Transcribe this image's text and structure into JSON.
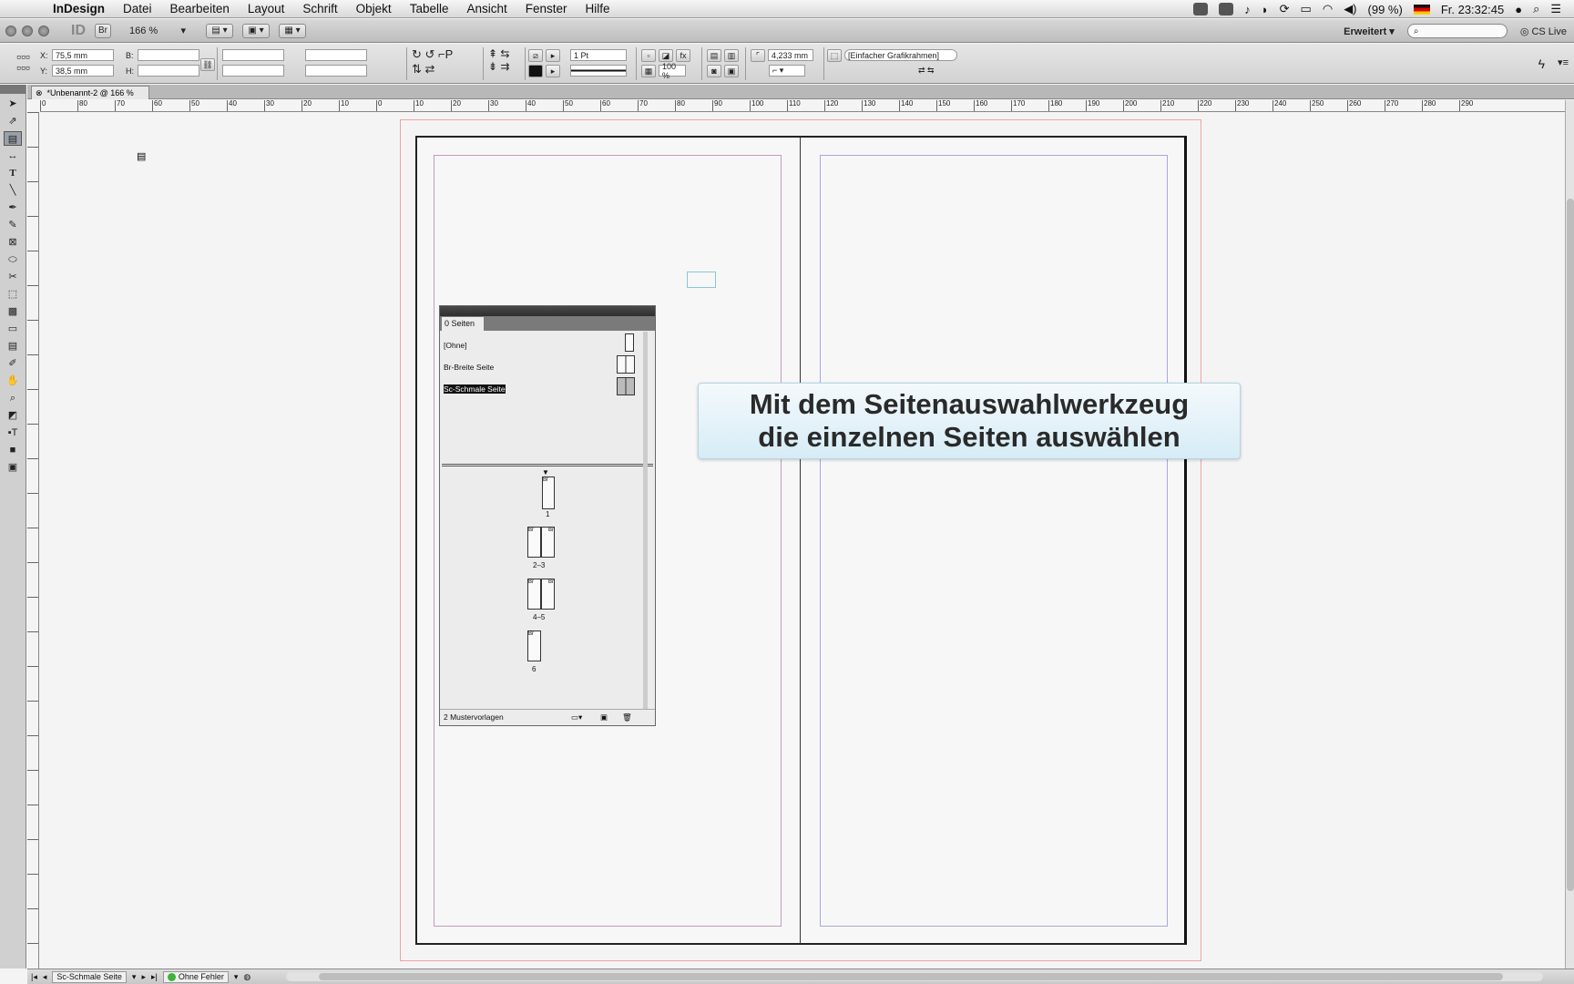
{
  "menubar": {
    "app_name": "InDesign",
    "items": [
      "Datei",
      "Bearbeiten",
      "Layout",
      "Schrift",
      "Objekt",
      "Tabelle",
      "Ansicht",
      "Fenster",
      "Hilfe"
    ],
    "battery": "(99 %)",
    "clock": "Fr. 23:32:45"
  },
  "appbar": {
    "logo": "ID",
    "bridge": "Br",
    "zoom": "166 %",
    "workspace": "Erweitert ▾",
    "cs_live": "CS Live"
  },
  "control": {
    "x_label": "X:",
    "x_value": "75,5 mm",
    "y_label": "Y:",
    "y_value": "38,5 mm",
    "w_label": "B:",
    "h_label": "H:",
    "stroke_weight": "1 Pt",
    "opacity": "100 %",
    "offset": "4,233 mm",
    "object_style": "[Einfacher Grafikrahmen]"
  },
  "document": {
    "tab_title": "*Unbenannt-2 @ 166 %"
  },
  "hruler_labels": [
    "0",
    "80",
    "70",
    "60",
    "50",
    "40",
    "30",
    "20",
    "10",
    "0",
    "10",
    "20",
    "30",
    "40",
    "50",
    "60",
    "70",
    "80",
    "90",
    "100",
    "110",
    "120",
    "130",
    "140",
    "150",
    "160",
    "170",
    "180",
    "190",
    "200",
    "210",
    "220",
    "230",
    "240",
    "250",
    "260",
    "270",
    "280",
    "290"
  ],
  "pages_panel": {
    "tab_label": "0 Seiten",
    "masters": [
      {
        "label": "[Ohne]"
      },
      {
        "label": "Br-Breite Seite"
      },
      {
        "label": "Sc-Schmale Seite",
        "selected": true
      }
    ],
    "pages": [
      {
        "label": "1",
        "prefix": "Br"
      },
      {
        "label": "2–3",
        "prefix_l": "Br",
        "prefix_r": "Br"
      },
      {
        "label": "4–5",
        "prefix_l": "Br",
        "prefix_r": "Br"
      },
      {
        "label": "6",
        "prefix": "Br"
      }
    ],
    "footer": "2 Mustervorlagen"
  },
  "caption": {
    "line1": "Mit dem Seitenauswahlwerkzeug",
    "line2": "die einzelnen Seiten auswählen"
  },
  "statusbar": {
    "page_field": "Sc-Schmale Seite",
    "preflight": "Ohne Fehler"
  },
  "colors": {
    "caption_bg": "#d6ecf6",
    "preflight_ok": "#3cb43c",
    "margin_guide": "#c49bb8"
  }
}
